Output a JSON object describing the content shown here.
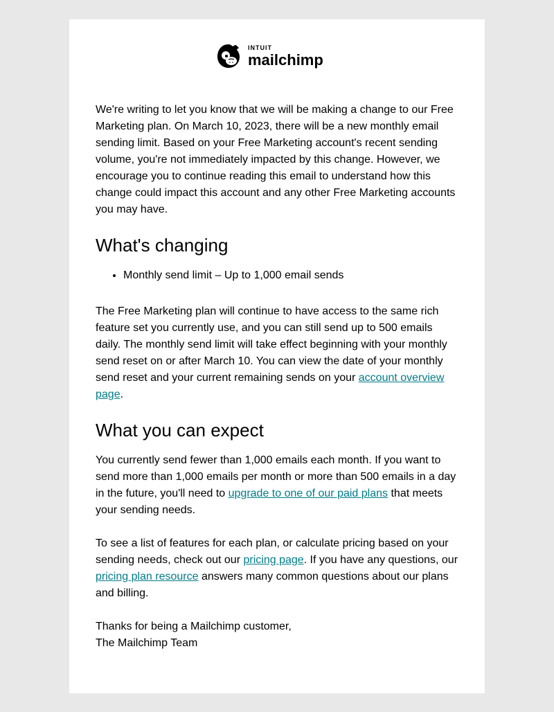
{
  "logo": {
    "prefix": "INTUIT",
    "name": "mailchimp"
  },
  "intro": "We're writing to let you know that we will be making a change to our Free Marketing plan. On March 10, 2023, there will be a new monthly email sending limit. Based on your Free Marketing account's recent sending volume, you're not immediately impacted by this change. However, we encourage you to continue reading this email to understand how this change could impact this account and any other Free Marketing accounts you may have.",
  "section1": {
    "heading": "What's changing",
    "bullet1": "Monthly send limit – Up to 1,000 email sends",
    "para_before_link": "The Free Marketing plan will continue to have access to the same rich feature set you currently use, and you can still send up to 500 emails daily. The monthly send limit will take effect beginning with your monthly send reset on or after March 10. You can view the date of your monthly send reset and your current remaining sends on your ",
    "link_text": "account overview page",
    "para_after_link": "."
  },
  "section2": {
    "heading": "What you can expect",
    "p1_before": "You currently send fewer than 1,000 emails each month. If you want to send more than 1,000 emails per month or more than 500 emails in a day in the future, you'll need to ",
    "p1_link": "upgrade to one of our paid plans",
    "p1_after": " that meets your sending needs.",
    "p2_before": "To see a list of features for each plan, or calculate pricing based on your sending needs, check out our ",
    "p2_link1": "pricing page",
    "p2_mid": ". If you have any questions, our ",
    "p2_link2": "pricing plan resource",
    "p2_after": " answers many common questions about our plans and billing."
  },
  "signoff": {
    "line1": "Thanks for being a Mailchimp customer,",
    "line2": "The Mailchimp Team"
  }
}
